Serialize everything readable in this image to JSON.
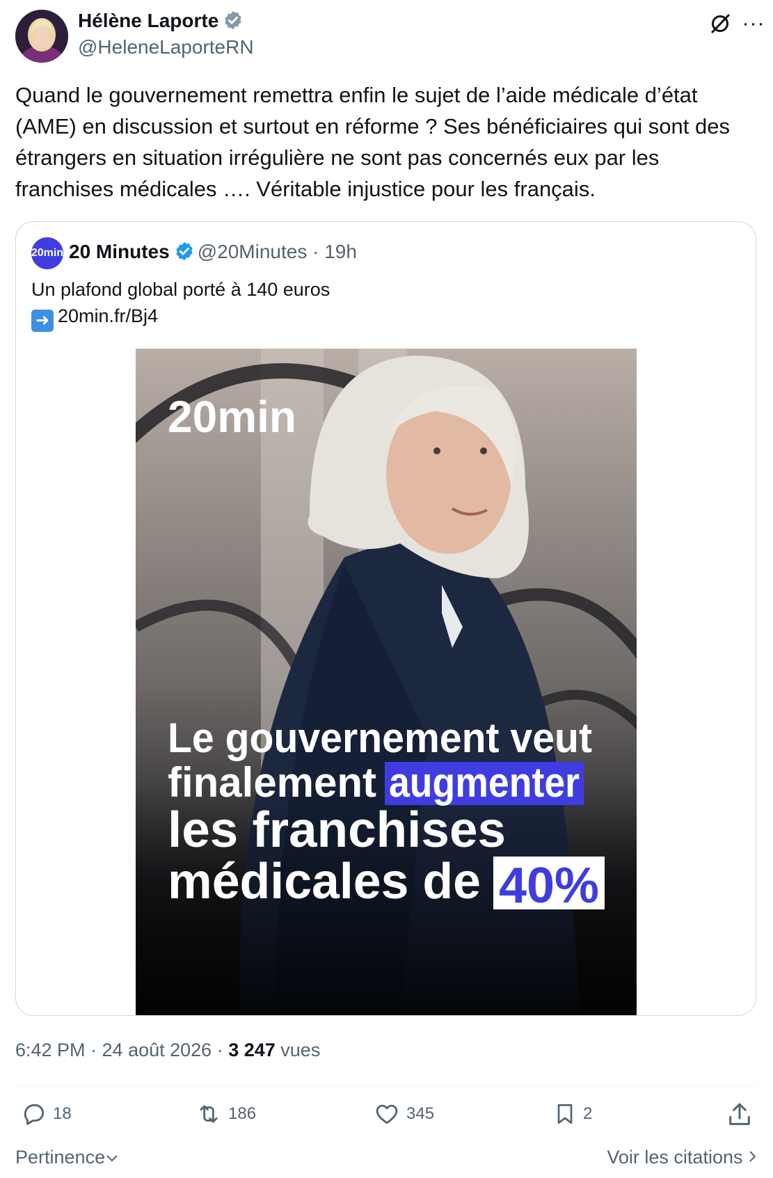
{
  "author": {
    "name": "Hélène Laporte",
    "handle": "@HeleneLaporteRN",
    "verified": true,
    "verified_color": "#829aab"
  },
  "header_icons": [
    "grok-icon",
    "more-icon"
  ],
  "tweet": {
    "text": "Quand le gouvernement remettra enfin le sujet de l’aide médicale d’état (AME) en discussion et surtout en réforme ? Ses bénéficiaires qui sont des étrangers en situation irrégulière ne sont pas concernés eux par les franchises médicales …. Véritable injustice pour les français."
  },
  "quote": {
    "name": "20 Minutes",
    "handle": "@20Minutes · 19h",
    "avatar_text": "20min",
    "verified_color": "#1d9bf0",
    "text_line1": "Un plafond global porté à 140 euros",
    "link": "20min.fr/Bj4",
    "image": {
      "logo": "20min",
      "headline_line1": "Le gouvernement veut",
      "headline_line2a": "finalement ",
      "headline_line2b": "augmenter",
      "headline_line3": "les franchises",
      "headline_line4a": "médicales de ",
      "headline_line4b": "40%",
      "accent": "#3f3de0"
    }
  },
  "meta": {
    "time": "6:42 PM · 24 août 2026 · ",
    "views_count": "3 247",
    "views_label": " vues"
  },
  "actions": {
    "replies": "18",
    "reposts": "186",
    "likes": "345",
    "bookmarks": "2"
  },
  "footer": {
    "sort_label": "Pertinence",
    "quotes_label": "Voir les citations"
  }
}
